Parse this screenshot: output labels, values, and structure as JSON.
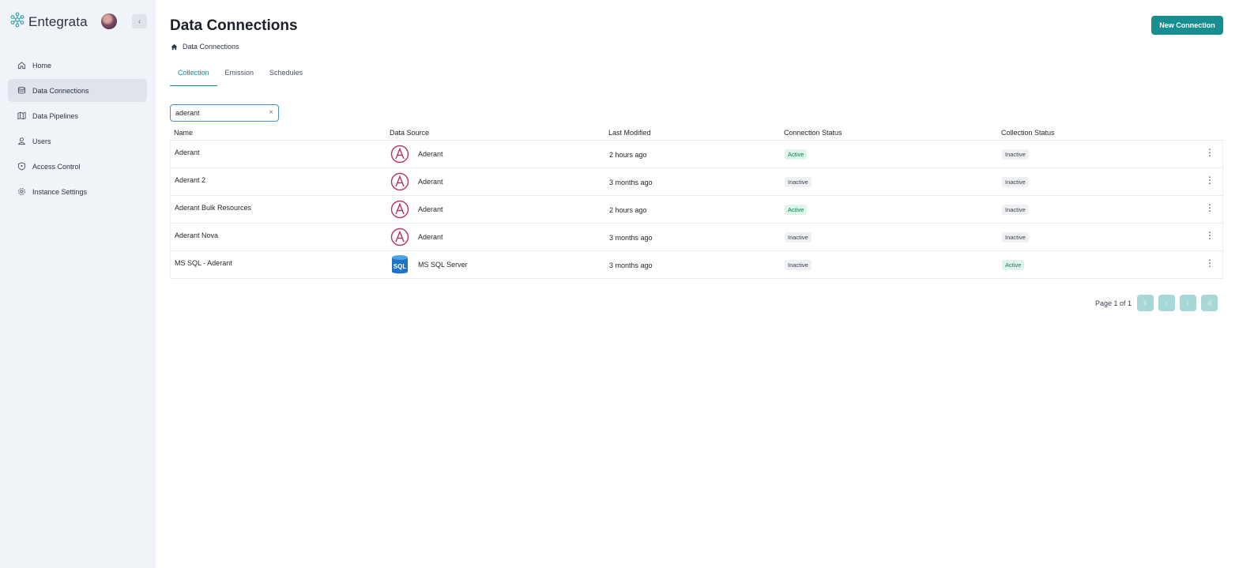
{
  "brand": {
    "name": "Entegrata",
    "collapse_glyph": "‹"
  },
  "sidebar": {
    "items": [
      {
        "label": "Home",
        "icon": "home-icon",
        "active": false
      },
      {
        "label": "Data Connections",
        "icon": "database-icon",
        "active": true
      },
      {
        "label": "Data Pipelines",
        "icon": "map-icon",
        "active": false
      },
      {
        "label": "Users",
        "icon": "user-icon",
        "active": false
      },
      {
        "label": "Access Control",
        "icon": "shield-icon",
        "active": false
      },
      {
        "label": "Instance Settings",
        "icon": "gear-icon",
        "active": false
      }
    ]
  },
  "header": {
    "title": "Data Connections",
    "new_button": "New Connection"
  },
  "breadcrumb": {
    "label": "Data Connections"
  },
  "tabs": [
    {
      "label": "Collection"
    },
    {
      "label": "Emission"
    },
    {
      "label": "Schedules"
    }
  ],
  "search": {
    "value": "aderant",
    "clear_glyph": "×"
  },
  "table": {
    "headers": [
      "Name",
      "Data Source",
      "Last Modified",
      "Connection Status",
      "Collection Status"
    ],
    "rows": [
      {
        "name": "Aderant",
        "source": "Aderant",
        "source_icon": "aderant-logo-icon",
        "modified": "2 hours ago",
        "connection": "Active",
        "collection": "Inactive"
      },
      {
        "name": "Aderant 2",
        "source": "Aderant",
        "source_icon": "aderant-logo-icon",
        "modified": "3 months ago",
        "connection": "Inactive",
        "collection": "Inactive"
      },
      {
        "name": "Aderant Bulk Resources",
        "source": "Aderant",
        "source_icon": "aderant-logo-icon",
        "modified": "2 hours ago",
        "connection": "Active",
        "collection": "Inactive"
      },
      {
        "name": "Aderant Nova",
        "source": "Aderant",
        "source_icon": "aderant-logo-icon",
        "modified": "3 months ago",
        "connection": "Inactive",
        "collection": "Inactive"
      },
      {
        "name": "MS SQL - Aderant",
        "source": "MS SQL Server",
        "source_icon": "sql-server-icon",
        "modified": "3 months ago",
        "connection": "Inactive",
        "collection": "Active"
      }
    ]
  },
  "pager": {
    "text": "Page 1 of 1",
    "first": "|‹",
    "prev": "‹",
    "next": "›",
    "last": "›|"
  },
  "colors": {
    "accent": "#178f91",
    "active_bg": "#dff5ec",
    "inactive_bg": "#eef0f3",
    "sidebar_bg": "#f0f3f7"
  }
}
